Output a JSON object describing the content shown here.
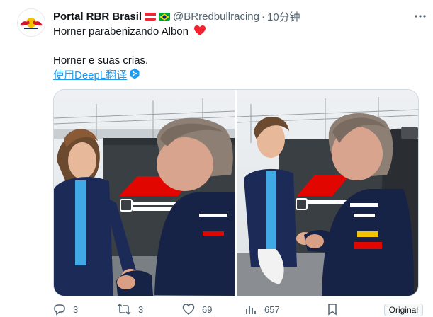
{
  "author": {
    "name": "Portal RBR Brasil",
    "handle": "@BRredbullracing",
    "separator": "·",
    "time": "10分钟",
    "flags": [
      "austria-flag-icon",
      "brazil-flag-icon"
    ]
  },
  "post": {
    "line1": "Horner parabenizando Albon",
    "line2": "Horner e suas crias.",
    "translate_label": "使用DeepL翻译"
  },
  "actions": {
    "replies": "3",
    "reposts": "3",
    "likes": "69",
    "views": "657"
  },
  "badge": "Original",
  "colors": {
    "link": "#1d9bf0",
    "heart": "#f4212e",
    "muted": "#536471",
    "border": "#cfd9de"
  }
}
